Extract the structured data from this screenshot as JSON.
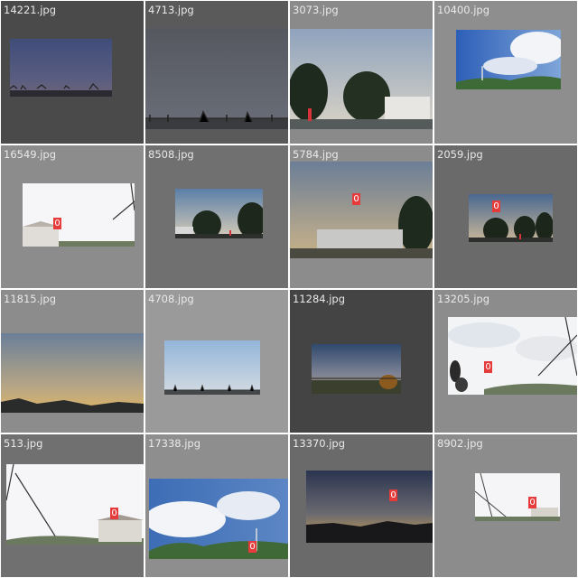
{
  "grid": {
    "tiles": [
      {
        "filename": "14221.jpg",
        "background": "#4a4a4a",
        "scene": "dusk_fence",
        "labels": []
      },
      {
        "filename": "4713.jpg",
        "background": "#5a5a5a",
        "scene": "gray_fence",
        "labels": []
      },
      {
        "filename": "3073.jpg",
        "background": "#8a8a8a",
        "scene": "trees_building",
        "labels": []
      },
      {
        "filename": "10400.jpg",
        "background": "#8e8e8e",
        "scene": "blue_hill_tower",
        "labels": []
      },
      {
        "filename": "16549.jpg",
        "background": "#8c8c8c",
        "scene": "white_sky_house",
        "labels": [
          "0"
        ]
      },
      {
        "filename": "8508.jpg",
        "background": "#707070",
        "scene": "evening_trees",
        "labels": []
      },
      {
        "filename": "5784.jpg",
        "background": "#8c8c8c",
        "scene": "evening_building",
        "labels": [
          "0"
        ]
      },
      {
        "filename": "2059.jpg",
        "background": "#6a6a6a",
        "scene": "evening_trees_small",
        "labels": [
          "0"
        ]
      },
      {
        "filename": "11815.jpg",
        "background": "#8c8c8c",
        "scene": "sunset_wide",
        "labels": []
      },
      {
        "filename": "4708.jpg",
        "background": "#9a9a9a",
        "scene": "blue_fence",
        "labels": []
      },
      {
        "filename": "11284.jpg",
        "background": "#444444",
        "scene": "dark_dusk_field",
        "labels": []
      },
      {
        "filename": "13205.jpg",
        "background": "#8c8c8c",
        "scene": "cloud_person",
        "labels": [
          "0"
        ]
      },
      {
        "filename": "513.jpg",
        "background": "#707070",
        "scene": "white_wires_house",
        "labels": [
          "0"
        ]
      },
      {
        "filename": "17338.jpg",
        "background": "#8e8e8e",
        "scene": "blue_hills_tower",
        "labels": [
          "0"
        ]
      },
      {
        "filename": "13370.jpg",
        "background": "#6a6a6a",
        "scene": "dark_sunset",
        "labels": [
          "0"
        ]
      },
      {
        "filename": "8902.jpg",
        "background": "#8c8c8c",
        "scene": "small_white",
        "labels": [
          "0"
        ]
      }
    ]
  }
}
